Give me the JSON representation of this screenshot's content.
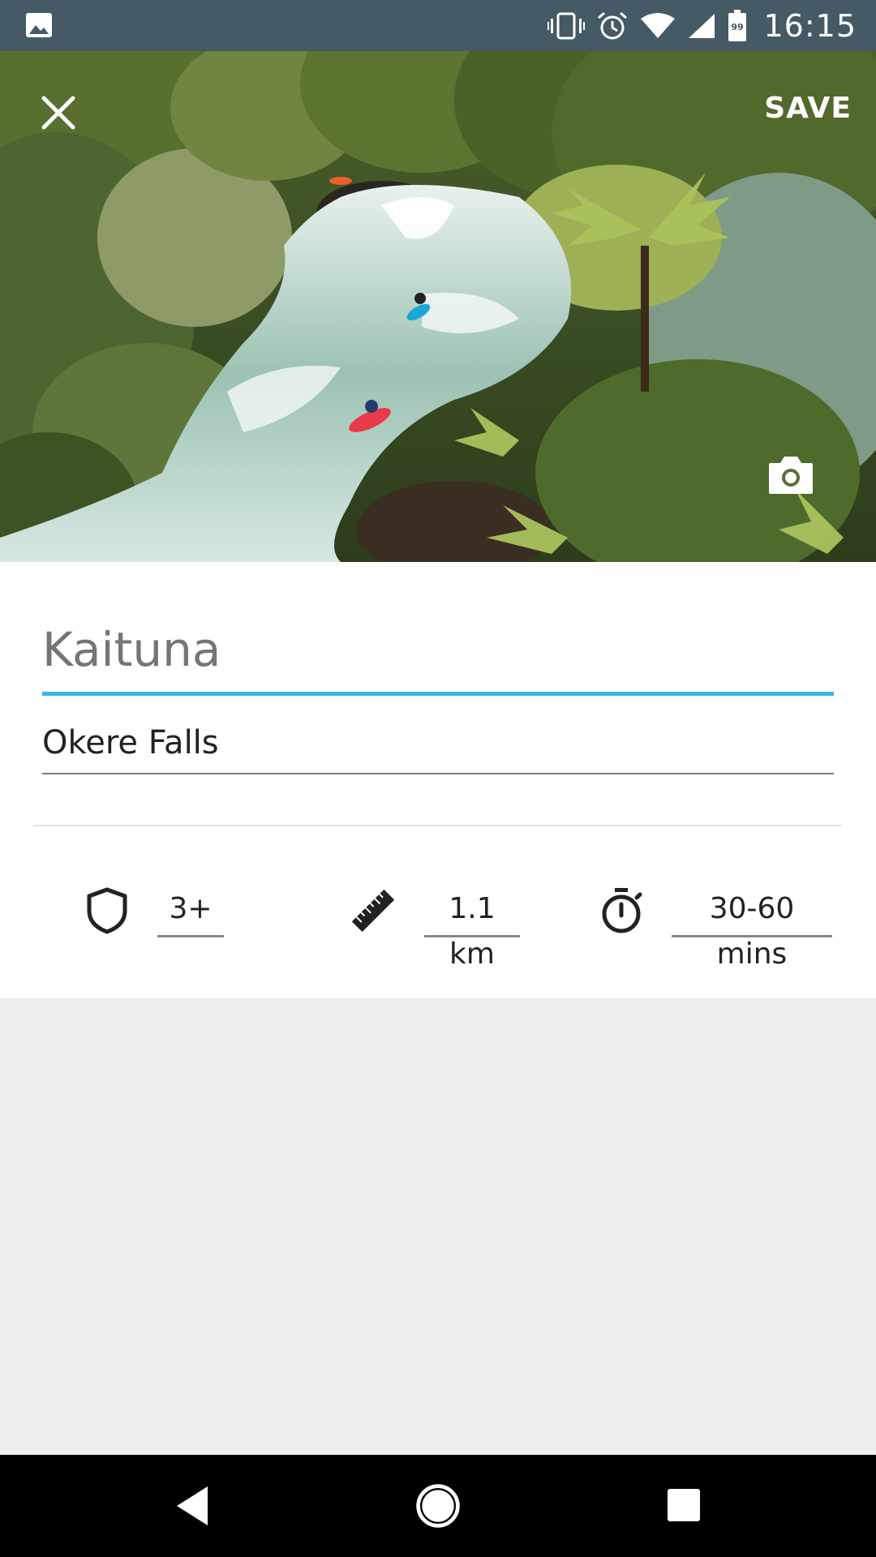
{
  "status_bar": {
    "time": "16:15",
    "battery_level": "99",
    "icons": [
      "image-icon",
      "vibrate-icon",
      "alarm-icon",
      "wifi-icon",
      "signal-icon",
      "battery-icon"
    ]
  },
  "header": {
    "close_icon": "close-icon",
    "save_label": "SAVE",
    "camera_icon": "camera-icon"
  },
  "form": {
    "title_placeholder": "Kaituna",
    "title_value": "",
    "subtitle_value": "Okere Falls",
    "accent_color": "#3bb6e8"
  },
  "stats": {
    "grade": {
      "icon": "shield-icon",
      "value": "3+"
    },
    "length": {
      "icon": "ruler-icon",
      "value": "1.1 km"
    },
    "duration": {
      "icon": "stopwatch-icon",
      "value": "30-60 mins"
    }
  },
  "nav": {
    "icons": [
      "back-icon",
      "home-icon",
      "recents-icon"
    ]
  }
}
